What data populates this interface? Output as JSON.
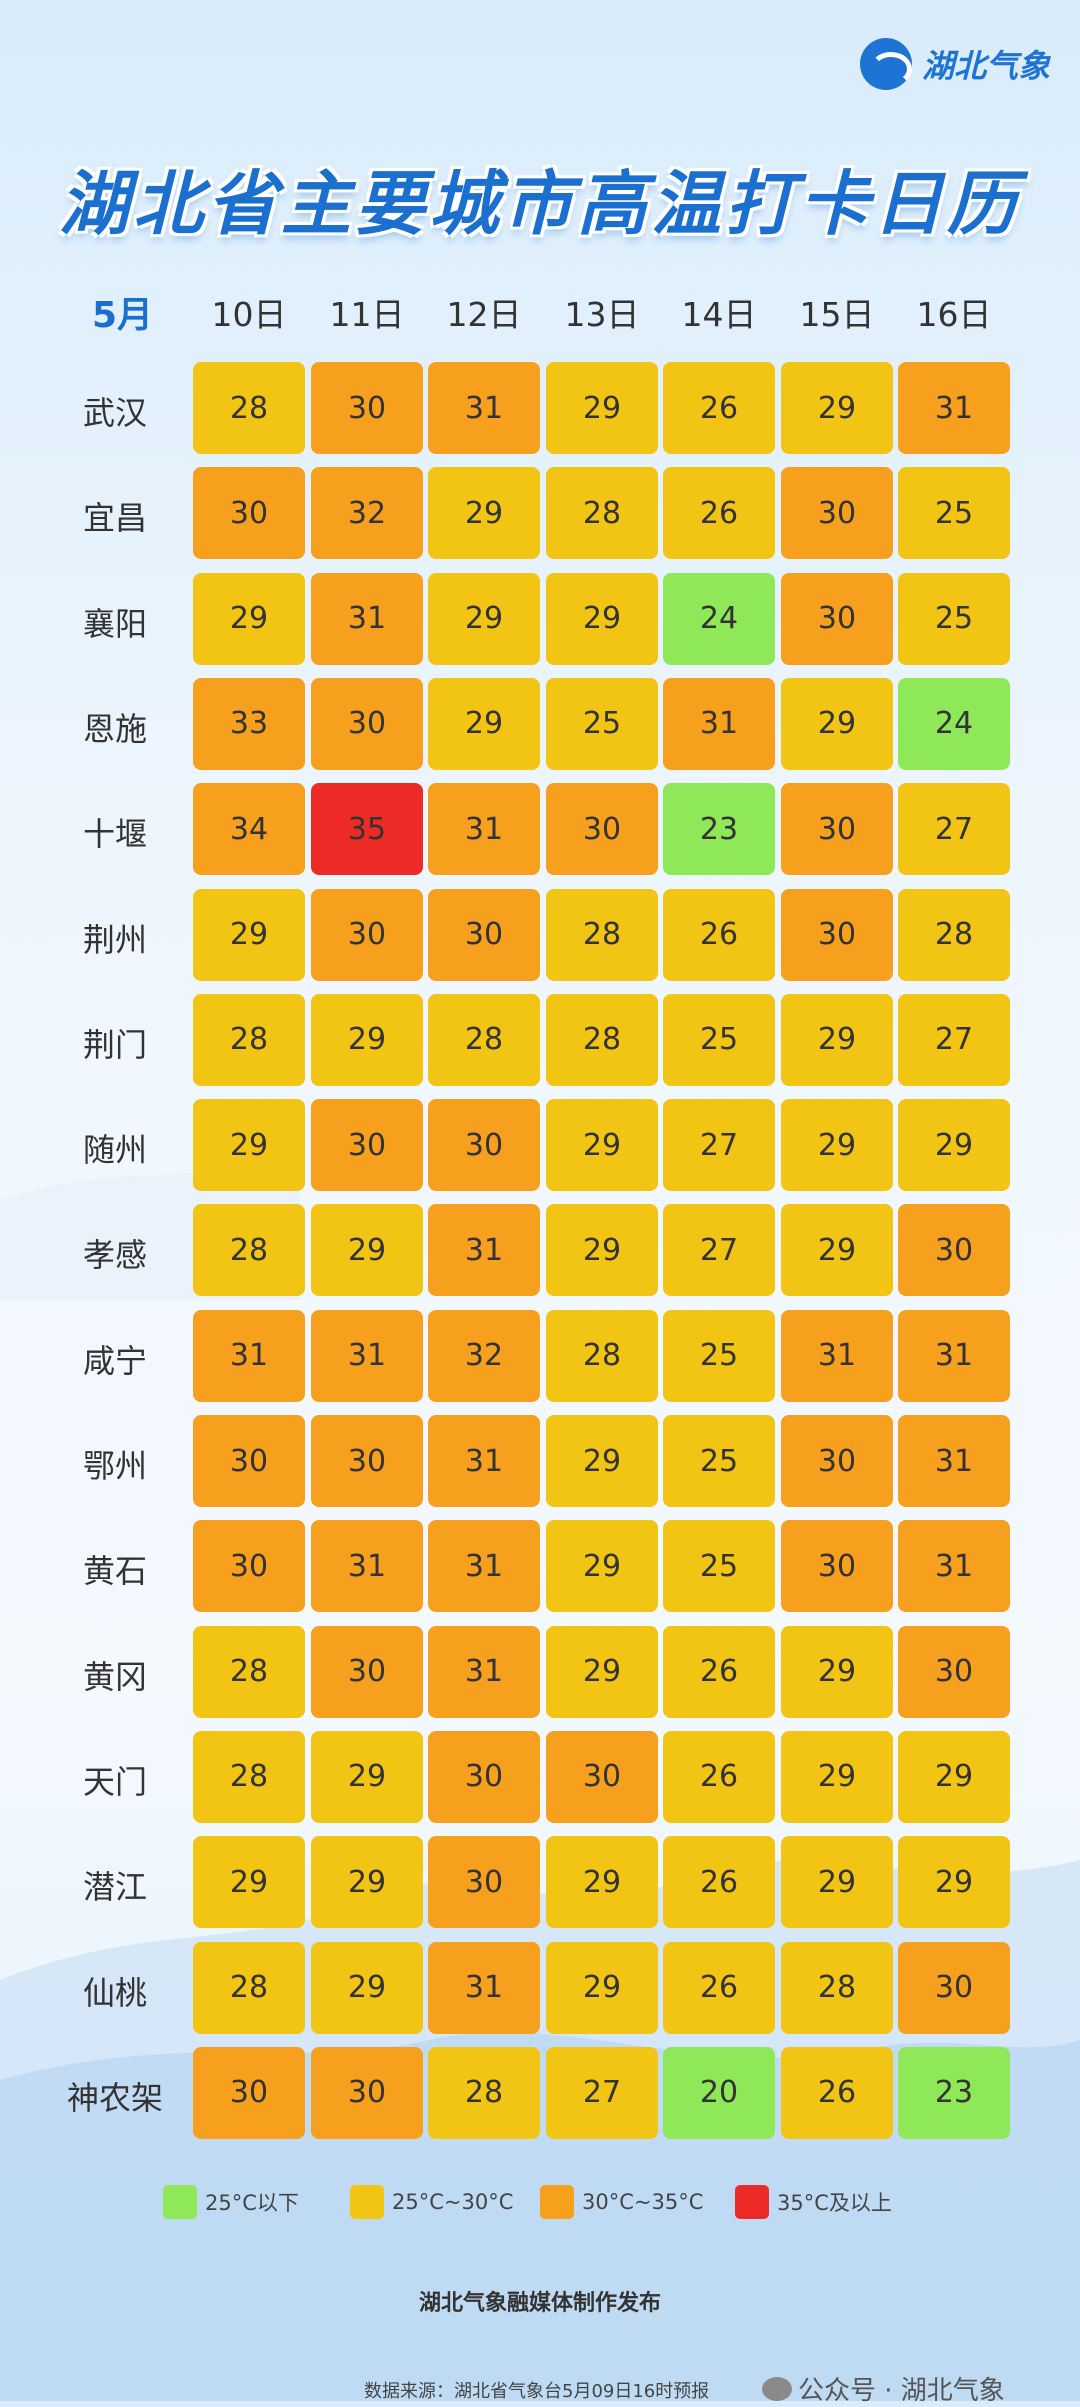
{
  "brand": {
    "name": "湖北气象"
  },
  "title": "湖北省主要城市高温打卡日历",
  "chart_data": {
    "type": "heatmap",
    "title": "湖北省主要城市高温打卡日历",
    "month": "5月",
    "columns": [
      "10日",
      "11日",
      "12日",
      "13日",
      "14日",
      "15日",
      "16日"
    ],
    "rows": [
      "武汉",
      "宜昌",
      "襄阳",
      "恩施",
      "十堰",
      "荆州",
      "荆门",
      "随州",
      "孝感",
      "咸宁",
      "鄂州",
      "黄石",
      "黄冈",
      "天门",
      "潜江",
      "仙桃",
      "神农架"
    ],
    "values": [
      [
        28,
        30,
        31,
        29,
        26,
        29,
        31
      ],
      [
        30,
        32,
        29,
        28,
        26,
        30,
        25
      ],
      [
        29,
        31,
        29,
        29,
        24,
        30,
        25
      ],
      [
        33,
        30,
        29,
        25,
        31,
        29,
        24
      ],
      [
        34,
        35,
        31,
        30,
        23,
        30,
        27
      ],
      [
        29,
        30,
        30,
        28,
        26,
        30,
        28
      ],
      [
        28,
        29,
        28,
        28,
        25,
        29,
        27
      ],
      [
        29,
        30,
        30,
        29,
        27,
        29,
        29
      ],
      [
        28,
        29,
        31,
        29,
        27,
        29,
        30
      ],
      [
        31,
        31,
        32,
        28,
        25,
        31,
        31
      ],
      [
        30,
        30,
        31,
        29,
        25,
        30,
        31
      ],
      [
        30,
        31,
        31,
        29,
        25,
        30,
        31
      ],
      [
        28,
        30,
        31,
        29,
        26,
        29,
        30
      ],
      [
        28,
        29,
        30,
        30,
        26,
        29,
        29
      ],
      [
        29,
        29,
        30,
        29,
        26,
        29,
        29
      ],
      [
        28,
        29,
        31,
        29,
        26,
        28,
        30
      ],
      [
        30,
        30,
        28,
        27,
        20,
        26,
        23
      ]
    ],
    "category_matrix": [
      [
        1,
        2,
        2,
        1,
        1,
        1,
        2
      ],
      [
        2,
        2,
        1,
        1,
        1,
        2,
        1
      ],
      [
        1,
        2,
        1,
        1,
        0,
        2,
        1
      ],
      [
        2,
        2,
        1,
        1,
        2,
        1,
        0
      ],
      [
        2,
        3,
        2,
        2,
        0,
        2,
        1
      ],
      [
        1,
        2,
        2,
        1,
        1,
        2,
        1
      ],
      [
        1,
        1,
        1,
        1,
        1,
        1,
        1
      ],
      [
        1,
        2,
        2,
        1,
        1,
        1,
        1
      ],
      [
        1,
        1,
        2,
        1,
        1,
        1,
        2
      ],
      [
        2,
        2,
        2,
        1,
        1,
        2,
        2
      ],
      [
        2,
        2,
        2,
        1,
        1,
        2,
        2
      ],
      [
        2,
        2,
        2,
        1,
        1,
        2,
        2
      ],
      [
        1,
        2,
        2,
        1,
        1,
        1,
        2
      ],
      [
        1,
        1,
        2,
        2,
        1,
        1,
        1
      ],
      [
        1,
        1,
        2,
        1,
        1,
        1,
        1
      ],
      [
        1,
        1,
        2,
        1,
        1,
        1,
        2
      ],
      [
        2,
        2,
        1,
        1,
        0,
        1,
        0
      ]
    ],
    "legend": [
      {
        "label": "25°C以下",
        "color": "#8ee857"
      },
      {
        "label": "25°C~30°C",
        "color": "#f2c414"
      },
      {
        "label": "30°C~35°C",
        "color": "#f7a01e"
      },
      {
        "label": "35°C及以上",
        "color": "#ec2b27"
      }
    ]
  },
  "footer": {
    "publisher": "湖北气象融媒体制作发布",
    "source": "数据来源：湖北省气象台5月09日16时预报",
    "wechat": "公众号 · 湖北气象"
  }
}
